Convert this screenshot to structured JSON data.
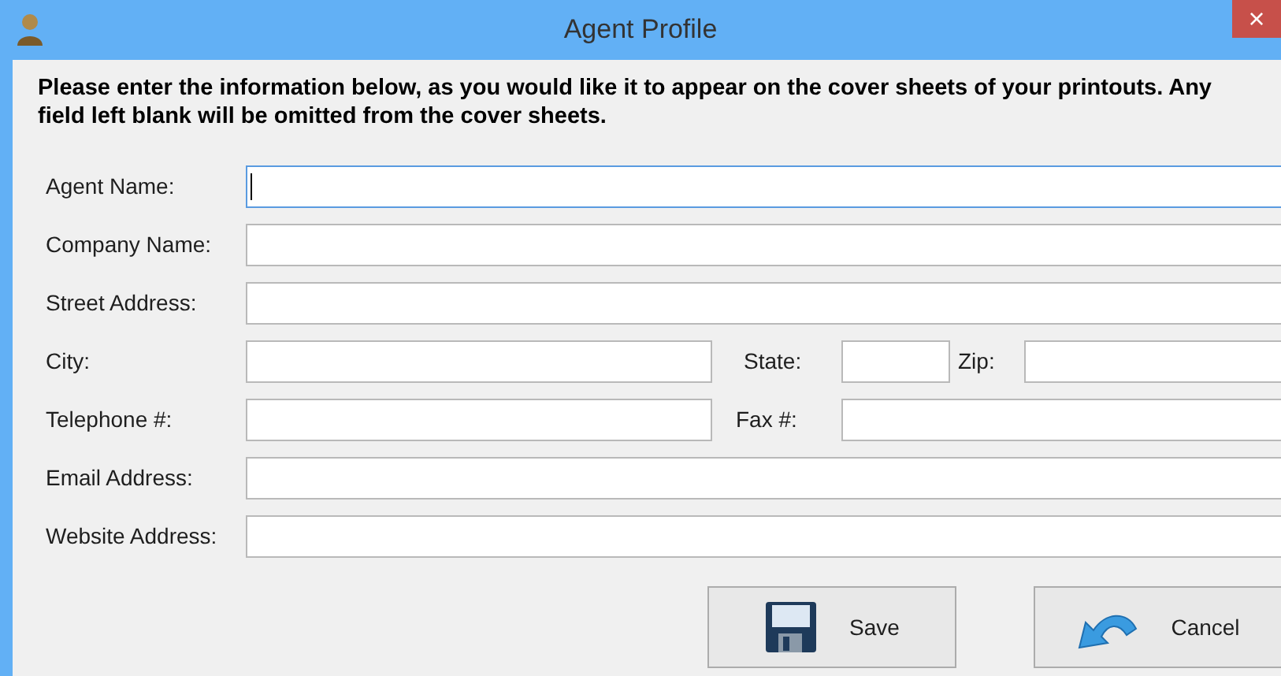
{
  "window": {
    "title": "Agent Profile",
    "close": "×"
  },
  "instructions": "Please enter the information below, as you would like it to appear on the cover sheets of your printouts. Any field left blank will be omitted from the cover sheets.",
  "rows": [
    {
      "fields": [
        {
          "kind": "wide",
          "label": "Agent Name:",
          "focused": true
        }
      ]
    },
    {
      "fields": [
        {
          "kind": "wide",
          "label": "Company Name:",
          "focused": false
        }
      ]
    },
    {
      "fields": [
        {
          "kind": "wide",
          "label": "Street Address:",
          "focused": false
        }
      ]
    },
    {
      "fields": [
        {
          "kind": "city",
          "label": "City:",
          "focused": false
        },
        {
          "kind": "state",
          "label": "State:",
          "focused": false
        },
        {
          "kind": "zip",
          "label": "Zip:",
          "focused": false
        }
      ]
    },
    {
      "fields": [
        {
          "kind": "city",
          "label": "Telephone #:",
          "focused": false
        },
        {
          "kind": "fax",
          "label": "Fax #:",
          "focused": false
        }
      ]
    },
    {
      "fields": [
        {
          "kind": "wide",
          "label": "Email Address:",
          "focused": false
        }
      ]
    },
    {
      "fields": [
        {
          "kind": "wide",
          "label": "Website Address:",
          "focused": false
        }
      ]
    }
  ],
  "buttons": [
    {
      "kind": "save",
      "label": "Save"
    },
    {
      "kind": "cancel",
      "label": "Cancel"
    }
  ]
}
